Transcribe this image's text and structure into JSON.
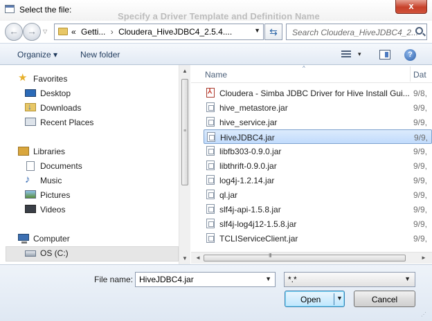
{
  "window": {
    "title": "Select the file:",
    "close_label": "x",
    "background_text": "Specify a Driver Template and Definition Name"
  },
  "navigation": {
    "back_label": "←",
    "forward_label": "→",
    "recent_label": "▽",
    "address": {
      "prefix": "«",
      "crumbs": [
        "Getti...",
        "Cloudera_HiveJDBC4_2.5.4...."
      ],
      "separator": "›",
      "dropdown": "▼"
    },
    "refresh_label": "⇆",
    "search_placeholder": "Search Cloudera_HiveJDBC4_2..."
  },
  "toolbar": {
    "organize_label": "Organize ▾",
    "new_folder_label": "New folder",
    "view_dropdown": "▾",
    "help_label": "?"
  },
  "sidebar": {
    "favorites_header": "Favorites",
    "favorites": [
      "Desktop",
      "Downloads",
      "Recent Places"
    ],
    "libraries_header": "Libraries",
    "libraries": [
      "Documents",
      "Music",
      "Pictures",
      "Videos"
    ],
    "computer_header": "Computer",
    "drives": [
      "OS (C:)"
    ],
    "scroll_up": "▲",
    "scroll_down": "▼",
    "scroll_grip": "≡"
  },
  "file_list": {
    "columns": [
      "Name",
      "Dat"
    ],
    "sort_indicator": "^",
    "files": [
      {
        "name": "Cloudera - Simba JDBC Driver for Hive Install Gui...",
        "date": "9/8,",
        "type": "pdf"
      },
      {
        "name": "hive_metastore.jar",
        "date": "9/9,",
        "type": "jar"
      },
      {
        "name": "hive_service.jar",
        "date": "9/9,",
        "type": "jar"
      },
      {
        "name": "HiveJDBC4.jar",
        "date": "9/9,",
        "type": "jar",
        "selected": true
      },
      {
        "name": "libfb303-0.9.0.jar",
        "date": "9/9,",
        "type": "jar"
      },
      {
        "name": "libthrift-0.9.0.jar",
        "date": "9/9,",
        "type": "jar"
      },
      {
        "name": "log4j-1.2.14.jar",
        "date": "9/9,",
        "type": "jar"
      },
      {
        "name": "ql.jar",
        "date": "9/9,",
        "type": "jar"
      },
      {
        "name": "slf4j-api-1.5.8.jar",
        "date": "9/9,",
        "type": "jar"
      },
      {
        "name": "slf4j-log4j12-1.5.8.jar",
        "date": "9/9,",
        "type": "jar"
      },
      {
        "name": "TCLIServiceClient.jar",
        "date": "9/9,",
        "type": "jar"
      }
    ],
    "scroll_left": "◄",
    "scroll_right": "►",
    "scroll_grip": "III"
  },
  "footer": {
    "filename_label": "File name:",
    "filename_value": "HiveJDBC4.jar",
    "filename_dropdown": "▼",
    "filter_value": "*.*",
    "filter_dropdown": "▼",
    "open_label": "Open",
    "open_dropdown": "▼",
    "cancel_label": "Cancel"
  }
}
